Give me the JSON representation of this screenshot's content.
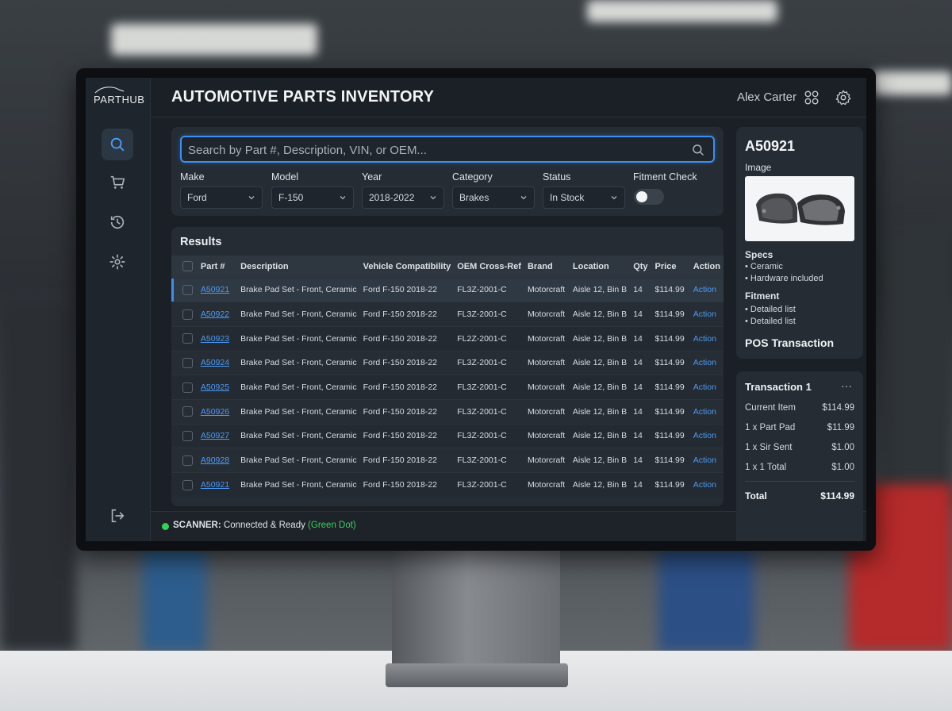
{
  "app": {
    "logo": "PARTHUB",
    "title": "AUTOMOTIVE PARTS INVENTORY",
    "user": "Alex Carter"
  },
  "search": {
    "placeholder": "Search by Part #, Description, VIN, or OEM..."
  },
  "filters": [
    {
      "label": "Make",
      "value": "Ford"
    },
    {
      "label": "Model",
      "value": "F-150"
    },
    {
      "label": "Year",
      "value": "2018-2022"
    },
    {
      "label": "Category",
      "value": "Brakes"
    },
    {
      "label": "Status",
      "value": "In Stock"
    }
  ],
  "fitment": {
    "label": "Fitment Check",
    "enabled": false
  },
  "results": {
    "title": "Results",
    "columns": [
      "Part #",
      "Description",
      "Vehicle Compatibility",
      "OEM Cross-Ref",
      "Brand",
      "Location",
      "Qty",
      "Price",
      "Action"
    ],
    "rows": [
      {
        "part": "A50921",
        "desc": "Brake Pad Set - Front, Ceramic",
        "compat": "Ford F-150 2018-22",
        "oem": "FL3Z-2001-C",
        "brand": "Motorcraft",
        "loc": "Aisle 12, Bin B",
        "qty": "14",
        "price": "$114.99",
        "action": "Action"
      },
      {
        "part": "A50922",
        "desc": "Brake Pad Set - Front, Ceramic",
        "compat": "Ford F-150 2018-22",
        "oem": "FL3Z-2001-C",
        "brand": "Motorcraft",
        "loc": "Aisle 12, Bin B",
        "qty": "14",
        "price": "$114.99",
        "action": "Action"
      },
      {
        "part": "A50923",
        "desc": "Brake Pad Set - Front, Ceramic",
        "compat": "Ford F-150 2018-22",
        "oem": "FL2Z-2001-C",
        "brand": "Motorcraft",
        "loc": "Aisle 12, Bin B",
        "qty": "14",
        "price": "$114.99",
        "action": "Action"
      },
      {
        "part": "A50924",
        "desc": "Brake Pad Set - Front, Ceramic",
        "compat": "Ford F-150 2018-22",
        "oem": "FL3Z-2001-C",
        "brand": "Motorcraft",
        "loc": "Aisle 12, Bin B",
        "qty": "14",
        "price": "$114.99",
        "action": "Action"
      },
      {
        "part": "A50925",
        "desc": "Brake Pad Set - Front, Ceramic",
        "compat": "Ford F-150 2018-22",
        "oem": "FL3Z-2001-C",
        "brand": "Motorcraft",
        "loc": "Aisle 12, Bin B",
        "qty": "14",
        "price": "$114.99",
        "action": "Action"
      },
      {
        "part": "A50926",
        "desc": "Brake Pad Set - Front, Ceramic",
        "compat": "Ford F-150 2018-22",
        "oem": "FL3Z-2001-C",
        "brand": "Motorcraft",
        "loc": "Aisle 12, Bin B",
        "qty": "14",
        "price": "$114.99",
        "action": "Action"
      },
      {
        "part": "A50927",
        "desc": "Brake Pad Set - Front, Ceramic",
        "compat": "Ford F-150 2018-22",
        "oem": "FL3Z-2001-C",
        "brand": "Motorcraft",
        "loc": "Aisle 12, Bin B",
        "qty": "14",
        "price": "$114.99",
        "action": "Action"
      },
      {
        "part": "A90928",
        "desc": "Brake Pad Set - Front, Ceramic",
        "compat": "Ford F-150 2018-22",
        "oem": "FL3Z-2001-C",
        "brand": "Motorcraft",
        "loc": "Aisle 12, Bin B",
        "qty": "14",
        "price": "$114.99",
        "action": "Action"
      },
      {
        "part": "A50921",
        "desc": "Brake Pad Set - Front, Ceramic",
        "compat": "Ford F-150 2018-22",
        "oem": "FL3Z-2001-C",
        "brand": "Motorcraft",
        "loc": "Aisle 12, Bin B",
        "qty": "14",
        "price": "$114.99",
        "action": "Action"
      }
    ]
  },
  "status": {
    "label": "SCANNER:",
    "text": "Connected & Ready",
    "indicator": "(Green Dot)",
    "color": "#34d058"
  },
  "detail": {
    "part_id": "A50921",
    "image_label": "Image",
    "specs_label": "Specs",
    "specs": [
      "• Ceramic",
      "• Hardware included"
    ],
    "fitment_label": "Fitment",
    "fitment": [
      "• Detailed list",
      "• Detailed list"
    ],
    "pos_label": "POS Transaction"
  },
  "transaction": {
    "title": "Transaction 1",
    "more": "···",
    "lines": [
      {
        "label": "Current Item",
        "amount": "$114.99"
      },
      {
        "label": "1 x Part Pad",
        "amount": "$11.99"
      },
      {
        "label": "1 x Sir Sent",
        "amount": "$1.00"
      },
      {
        "label": "1 x 1 Total",
        "amount": "$1.00"
      }
    ],
    "total_label": "Total",
    "total_amount": "$114.99"
  },
  "colors": {
    "accent": "#3d8ef0",
    "link": "#4d9bf5",
    "panel": "#252c34",
    "background": "#1b2026"
  },
  "icons": {
    "nav": [
      "search-icon",
      "cart-icon",
      "history-icon",
      "settings-icon",
      "logout-icon"
    ],
    "header": [
      "apps-grid-icon",
      "gear-icon"
    ]
  }
}
